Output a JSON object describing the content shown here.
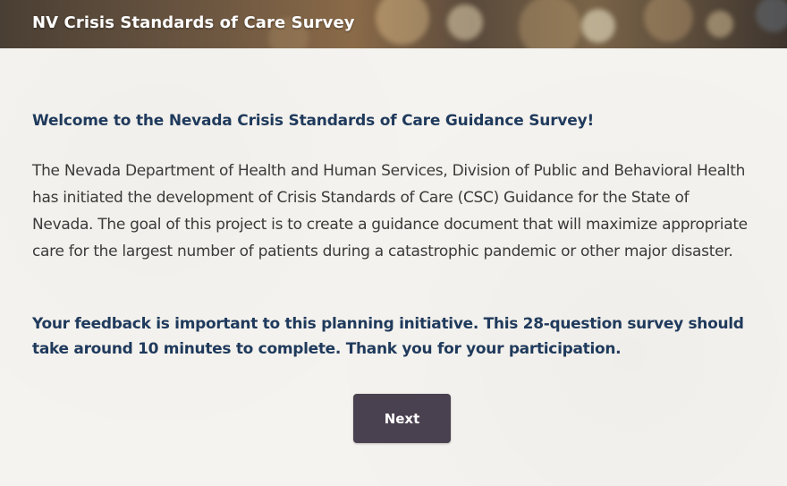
{
  "header": {
    "title": "NV Crisis Standards of Care Survey"
  },
  "main": {
    "welcome_heading": "Welcome to the Nevada Crisis Standards of Care Guidance Survey!",
    "intro_text": "The Nevada Department of Health and Human Services, Division of Public and Behavioral Health has initiated the development of Crisis Standards of Care (CSC) Guidance for the State of Nevada. The goal of this project is to create a guidance document that will maximize appropriate care for the largest number of patients during a catastrophic pandemic or other major disaster.",
    "feedback_text": "Your feedback is important to this planning initiative. This 28-question survey should take around 10 minutes to complete.  Thank you for your participation."
  },
  "footer": {
    "next_label": "Next"
  },
  "colors": {
    "heading": "#1f3a5c",
    "body_text": "#3a3a3a",
    "button_bg": "#4a4150",
    "page_bg": "#f5f3ef"
  }
}
